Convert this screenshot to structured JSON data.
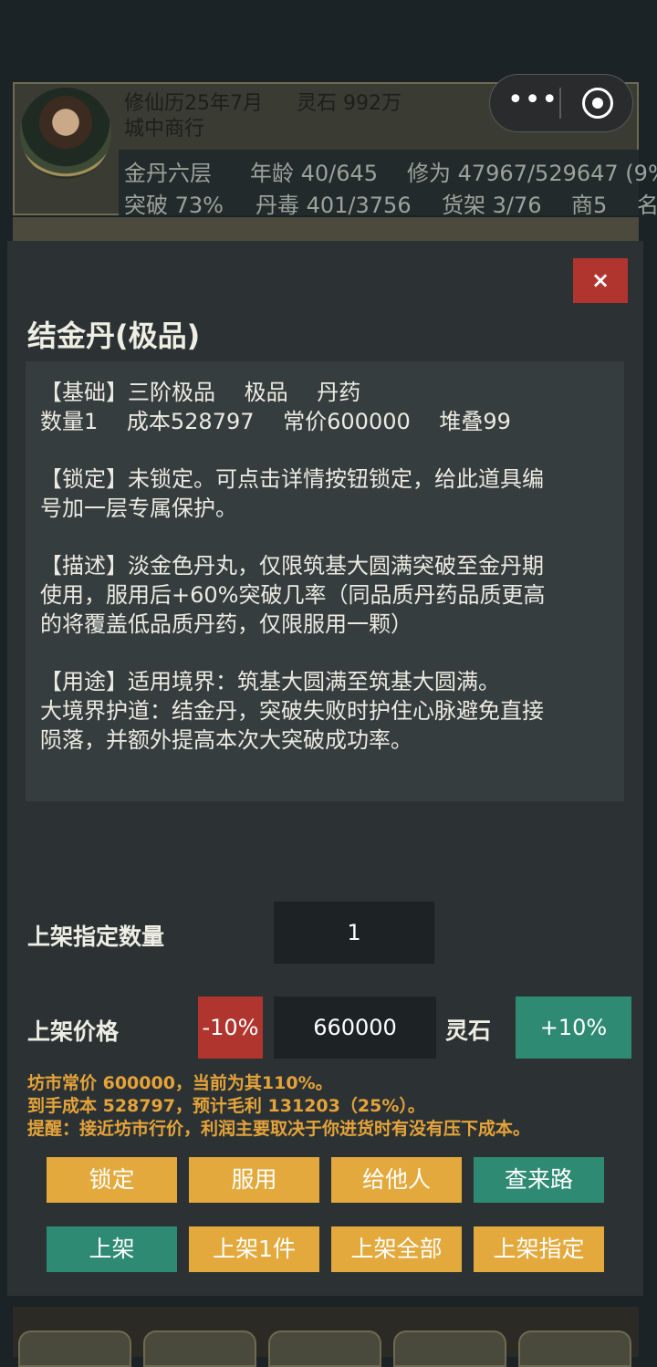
{
  "header": {
    "date": "修仙历25年7月",
    "spirit_stones": "灵石 992万",
    "location": "城中商行",
    "realm": "金丹六层",
    "age": "年龄 40/645",
    "cultivation": "修为 47967/529647 (9%",
    "breakthrough": "突破 73%",
    "pill_toxicity": "丹毒 401/3756",
    "shelves": "货架 3/76",
    "merchant": "商5",
    "cut_text": "名"
  },
  "capsule": {
    "more_icon": "more-dots-icon",
    "close_icon": "target-circle-icon"
  },
  "modal": {
    "close_label": "×",
    "title": "结金丹(极品)",
    "description_lines": [
      "【基础】三阶极品　 极品　 丹药",
      "数量1　 成本528797　 常价600000　 堆叠99",
      "",
      "【锁定】未锁定。可点击详情按钮锁定，给此道具编",
      "号加一层专属保护。",
      "",
      "【描述】淡金色丹丸，仅限筑基大圆满突破至金丹期",
      "使用，服用后+60%突破几率（同品质丹药品质更高",
      "的将覆盖低品质丹药，仅限服用一颗）",
      "",
      "【用途】适用境界：筑基大圆满至筑基大圆满。",
      "大境界护道：结金丹，突破失败时护住心脉避免直接",
      "陨落，并额外提高本次大突破成功率。"
    ],
    "quantity_label": "上架指定数量",
    "quantity_value": "1",
    "price_label": "上架价格",
    "minus_label": "-10%",
    "price_value": "660000",
    "price_unit": "灵石",
    "plus_label": "+10%",
    "notes": [
      "坊市常价 600000，当前为其110%。",
      "到手成本 528797，预计毛利 131203（25%）。",
      "提醒：接近坊市行价，利润主要取决于你进货时有没有压下成本。"
    ],
    "buttons_row1": [
      "锁定",
      "服用",
      "给他人",
      "查来路"
    ],
    "buttons_row2": [
      "上架",
      "上架1件",
      "上架全部",
      "上架指定"
    ]
  },
  "colors": {
    "gold": "#e3a93c",
    "green": "#2e8a72",
    "red": "#b1352f",
    "note": "#e5a33a"
  }
}
